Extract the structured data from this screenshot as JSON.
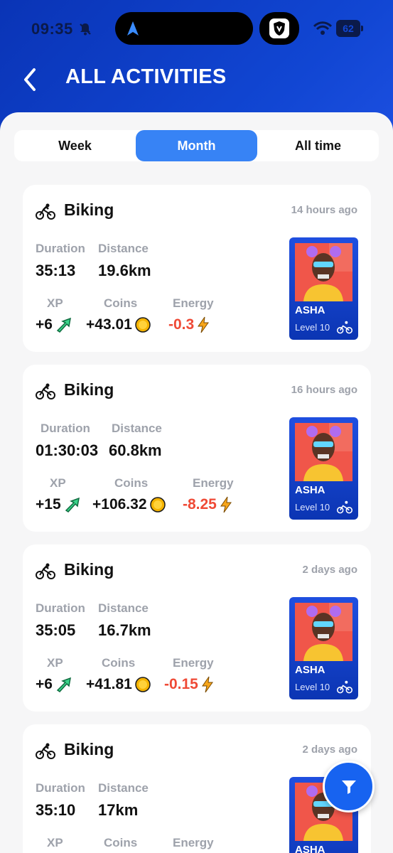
{
  "status_bar": {
    "time": "09:35",
    "battery": "62"
  },
  "header": {
    "title": "ALL ACTIVITIES"
  },
  "tabs": [
    {
      "label": "Week",
      "selected": false
    },
    {
      "label": "Month",
      "selected": true
    },
    {
      "label": "All time",
      "selected": false
    }
  ],
  "labels": {
    "duration": "Duration",
    "distance": "Distance",
    "xp": "XP",
    "coins": "Coins",
    "energy": "Energy"
  },
  "activities": [
    {
      "type": "Biking",
      "ago": "14 hours ago",
      "duration": "35:13",
      "distance": "19.6km",
      "xp": "+6",
      "coins": "+43.01",
      "energy": "-0.3",
      "avatar": {
        "name": "ASHA",
        "level": "Level 10"
      }
    },
    {
      "type": "Biking",
      "ago": "16 hours ago",
      "duration": "01:30:03",
      "distance": "60.8km",
      "xp": "+15",
      "coins": "+106.32",
      "energy": "-8.25",
      "avatar": {
        "name": "ASHA",
        "level": "Level 10"
      }
    },
    {
      "type": "Biking",
      "ago": "2 days ago",
      "duration": "35:05",
      "distance": "16.7km",
      "xp": "+6",
      "coins": "+41.81",
      "energy": "-0.15",
      "avatar": {
        "name": "ASHA",
        "level": "Level 10"
      }
    },
    {
      "type": "Biking",
      "ago": "2 days ago",
      "duration": "35:10",
      "distance": "17km",
      "xp": "",
      "coins": "",
      "energy": "",
      "avatar": {
        "name": "ASHA",
        "level": ""
      }
    }
  ],
  "colors": {
    "accent": "#3783f5",
    "header": "#0a34b6",
    "energy_negative": "#ef4a36",
    "avatar_bg": "#f0564a"
  }
}
